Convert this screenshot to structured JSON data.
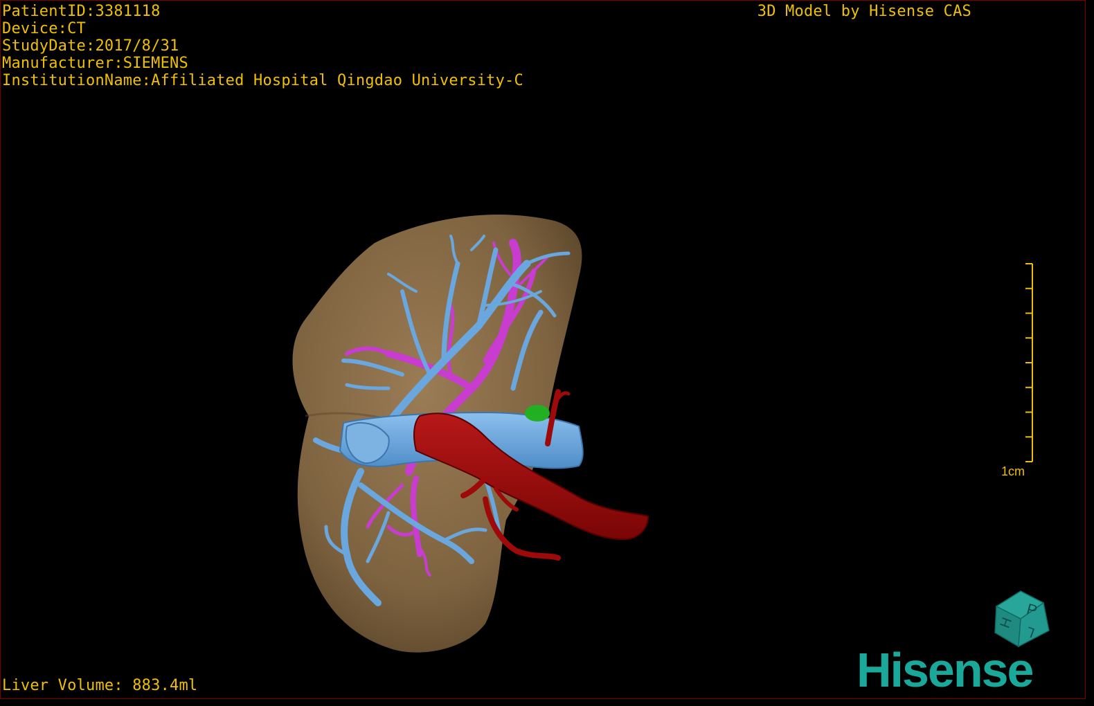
{
  "meta": {
    "patient_id": "PatientID:3381118",
    "device": "Device:CT",
    "study_date": "StudyDate:2017/8/31",
    "manufacturer": "Manufacturer:SIEMENS",
    "institution": "InstitutionName:Affiliated Hospital Qingdao University-C"
  },
  "brand_caption": "3D Model by Hisense CAS",
  "liver_volume": "Liver Volume: 883.4ml",
  "scale": {
    "label": "1cm",
    "tick_count": 9
  },
  "orientation_cube": {
    "letters": [
      "P",
      "H",
      "L"
    ]
  },
  "logo_text": "Hisense",
  "colors": {
    "overlay_text": "#f0c000",
    "liver": "#8a6d48",
    "portal_vein": "#6aa7de",
    "hepatic_vein": "#c83ccf",
    "artery": "#9e0a0a",
    "gallbladder": "#22b022",
    "logo": "#1aa89a",
    "border": "#7a0000"
  }
}
